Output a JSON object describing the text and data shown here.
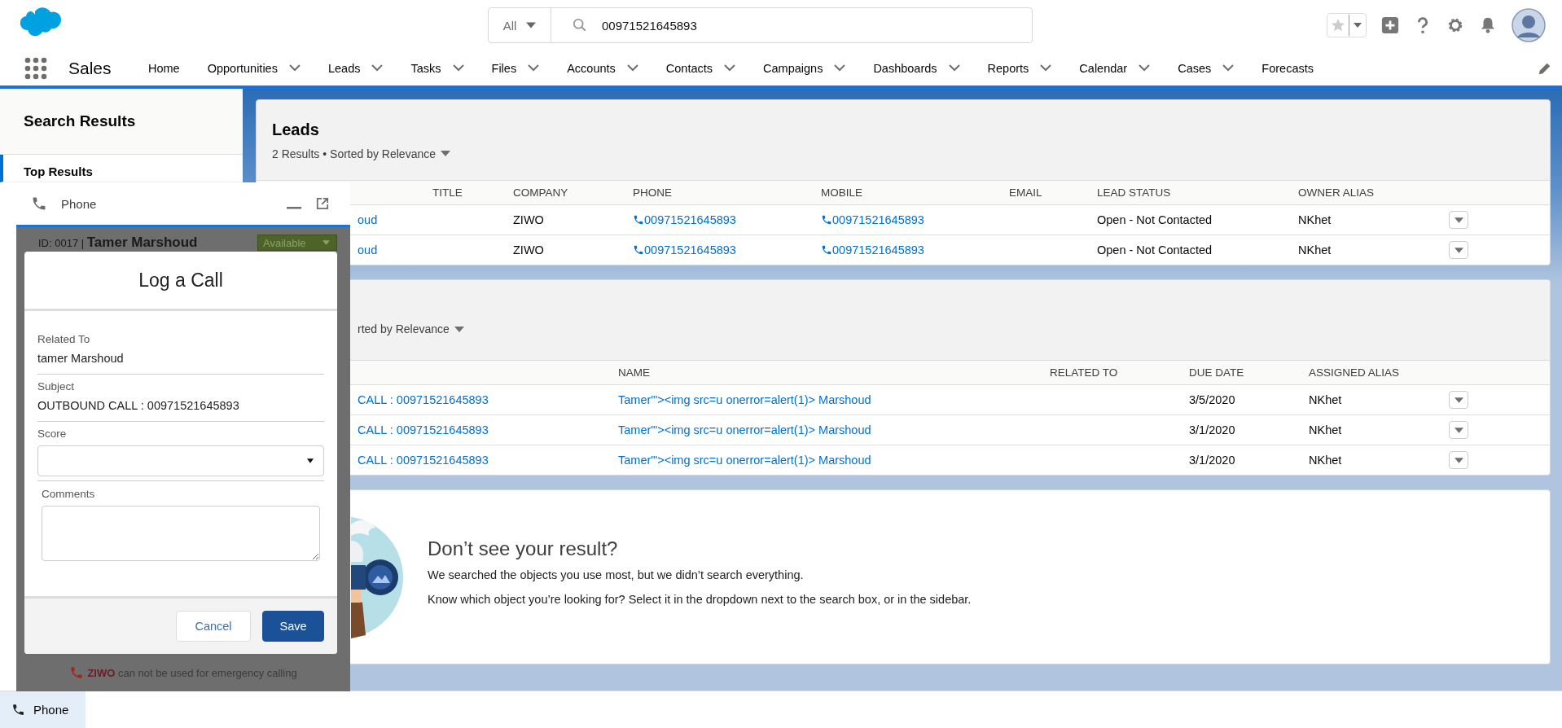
{
  "header": {
    "search": {
      "scope": "All",
      "value": "00971521645893"
    }
  },
  "nav": {
    "app_name": "Sales",
    "items": [
      {
        "label": "Home",
        "dropdown": false
      },
      {
        "label": "Opportunities",
        "dropdown": true
      },
      {
        "label": "Leads",
        "dropdown": true
      },
      {
        "label": "Tasks",
        "dropdown": true
      },
      {
        "label": "Files",
        "dropdown": true
      },
      {
        "label": "Accounts",
        "dropdown": true
      },
      {
        "label": "Contacts",
        "dropdown": true
      },
      {
        "label": "Campaigns",
        "dropdown": true
      },
      {
        "label": "Dashboards",
        "dropdown": true
      },
      {
        "label": "Reports",
        "dropdown": true
      },
      {
        "label": "Calendar",
        "dropdown": true
      },
      {
        "label": "Cases",
        "dropdown": true
      },
      {
        "label": "Forecasts",
        "dropdown": false
      }
    ]
  },
  "sidebar": {
    "title": "Search Results",
    "items": [
      {
        "label": "Top Results",
        "selected": true
      }
    ]
  },
  "leads": {
    "title": "Leads",
    "subtitle": "2 Results • Sorted by Relevance",
    "columns": [
      "TITLE",
      "COMPANY",
      "PHONE",
      "MOBILE",
      "EMAIL",
      "LEAD STATUS",
      "OWNER ALIAS"
    ],
    "rows": [
      {
        "name": "oud",
        "company": "ZIWO",
        "phone": "00971521645893",
        "mobile": "00971521645893",
        "lead_status": "Open - Not Contacted",
        "owner_alias": "NKhet"
      },
      {
        "name": "oud",
        "company": "ZIWO",
        "phone": "00971521645893",
        "mobile": "00971521645893",
        "lead_status": "Open - Not Contacted",
        "owner_alias": "NKhet"
      }
    ]
  },
  "tasks": {
    "subtitle": "rted by Relevance",
    "columns": [
      "NAME",
      "RELATED TO",
      "DUE DATE",
      "ASSIGNED ALIAS"
    ],
    "rows": [
      {
        "subject": "CALL : 00971521645893",
        "name": "Tamer'\"><img src=u onerror=alert(1)> Marshoud",
        "due_date": "3/5/2020",
        "assigned_alias": "NKhet"
      },
      {
        "subject": "CALL : 00971521645893",
        "name": "Tamer'\"><img src=u onerror=alert(1)> Marshoud",
        "due_date": "3/1/2020",
        "assigned_alias": "NKhet"
      },
      {
        "subject": "CALL : 00971521645893",
        "name": "Tamer'\"><img src=u onerror=alert(1)> Marshoud",
        "due_date": "3/1/2020",
        "assigned_alias": "NKhet"
      }
    ]
  },
  "empty_state": {
    "title": "Don’t see your result?",
    "lines": [
      "We searched the objects you use most, but we didn’t search everything.",
      "Know which object you’re looking for? Select it in the dropdown next to the search box, or in the sidebar."
    ]
  },
  "phone_panel": {
    "title": "Phone",
    "agent": "ID: 0017 | **Tamer Marshoud**",
    "status": "Available",
    "notice": "**ZIWO** can not be used for emergency calling",
    "log_call": {
      "title": "Log a Call",
      "fields": [
        {
          "kind": "text",
          "label": "Related To",
          "value": "tamer Marshoud"
        },
        {
          "kind": "text",
          "label": "Subject",
          "value": "OUTBOUND CALL : 00971521645893"
        },
        {
          "kind": "select",
          "label": "Score"
        },
        {
          "kind": "textarea",
          "label": "Comments"
        }
      ],
      "buttons": [
        {
          "label": "Cancel",
          "kind": "neutral"
        },
        {
          "label": "Save",
          "kind": "brand"
        }
      ]
    }
  },
  "utility_bar": {
    "items": [
      {
        "label": "Phone",
        "selected": true
      }
    ]
  }
}
